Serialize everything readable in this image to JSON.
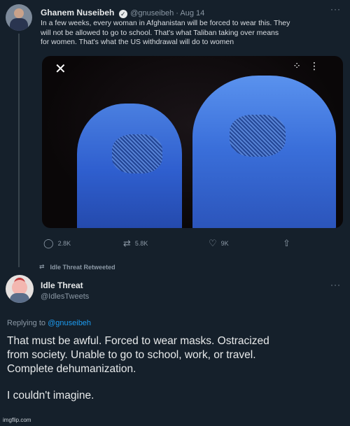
{
  "tweet1": {
    "author_name": "Ghanem Nuseibeh",
    "handle_date": "@gnuseibeh · Aug 14",
    "text_lines": [
      "In a few weeks, every woman in Afghanistan will be forced to wear this. They",
      "will not be allowed to go to school. That's what Taliban taking over means",
      "for women. That's what the US withdrawal will do to women"
    ],
    "more": "···",
    "actions": {
      "reply_count": "2.8K",
      "retweet_count": "5.8K",
      "like_count": "9K"
    }
  },
  "retweet_notice": "Idle Threat Retweeted",
  "tweet2": {
    "author_name": "Idle Threat",
    "handle": "@IdlesTweets",
    "more": "···",
    "replying_prefix": "Replying to",
    "replying_to": "@gnuseibeh",
    "text_lines": [
      "That must be awful. Forced to wear masks. Ostracized",
      "from society. Unable to go to school, work, or travel.",
      "Complete dehumanization."
    ],
    "text_last": "I couldn't imagine."
  },
  "watermark": "imgflip.com",
  "icons": {
    "verified": "verified-badge-icon",
    "close": "close-icon",
    "media_more": "more-icon",
    "reply": "reply-icon",
    "retweet": "retweet-icon",
    "like": "heart-icon",
    "share": "share-icon"
  }
}
